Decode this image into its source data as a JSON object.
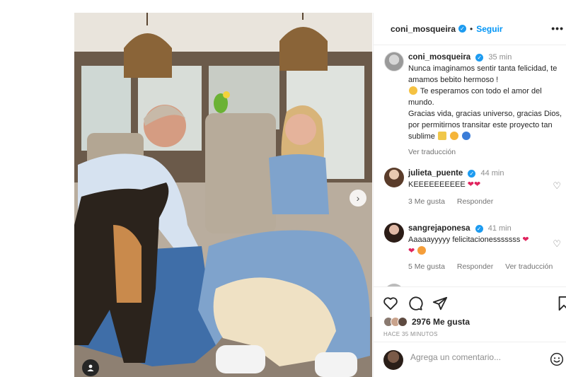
{
  "header": {
    "username": "coni_mosqueira",
    "follow_label": "Seguir",
    "more_label": "•••"
  },
  "caption": {
    "username": "coni_mosqueira",
    "time": "35 min",
    "line1": "Nunca imaginamos sentir tanta felicidad, te amamos bebito hermoso !",
    "line2": "Te esperamos con todo el amor del mundo.",
    "line3": "Gracias vida, gracias universo, gracias Dios, por permitirnos transitar este proyecto tan sublime",
    "translate_label": "Ver traducción"
  },
  "comments": [
    {
      "username": "julieta_puente",
      "time": "44 min",
      "text": "KEEEEEEEEEE",
      "likes_label": "3 Me gusta",
      "reply_label": "Responder"
    },
    {
      "username": "sangrejaponesa",
      "time": "41 min",
      "text": "Aaaaayyyyy felicitacionesssssss",
      "likes_label": "5 Me gusta",
      "reply_label": "Responder",
      "translate_label": "Ver traducción"
    }
  ],
  "likes": {
    "count_label": "2976 Me gusta",
    "when_label": "HACE 35 MINUTOS"
  },
  "add_comment": {
    "placeholder": "Agrega un comentario..."
  },
  "colors": {
    "accent": "#0095f6",
    "verified": "#1d9bf0",
    "heart": "#e0245e"
  }
}
